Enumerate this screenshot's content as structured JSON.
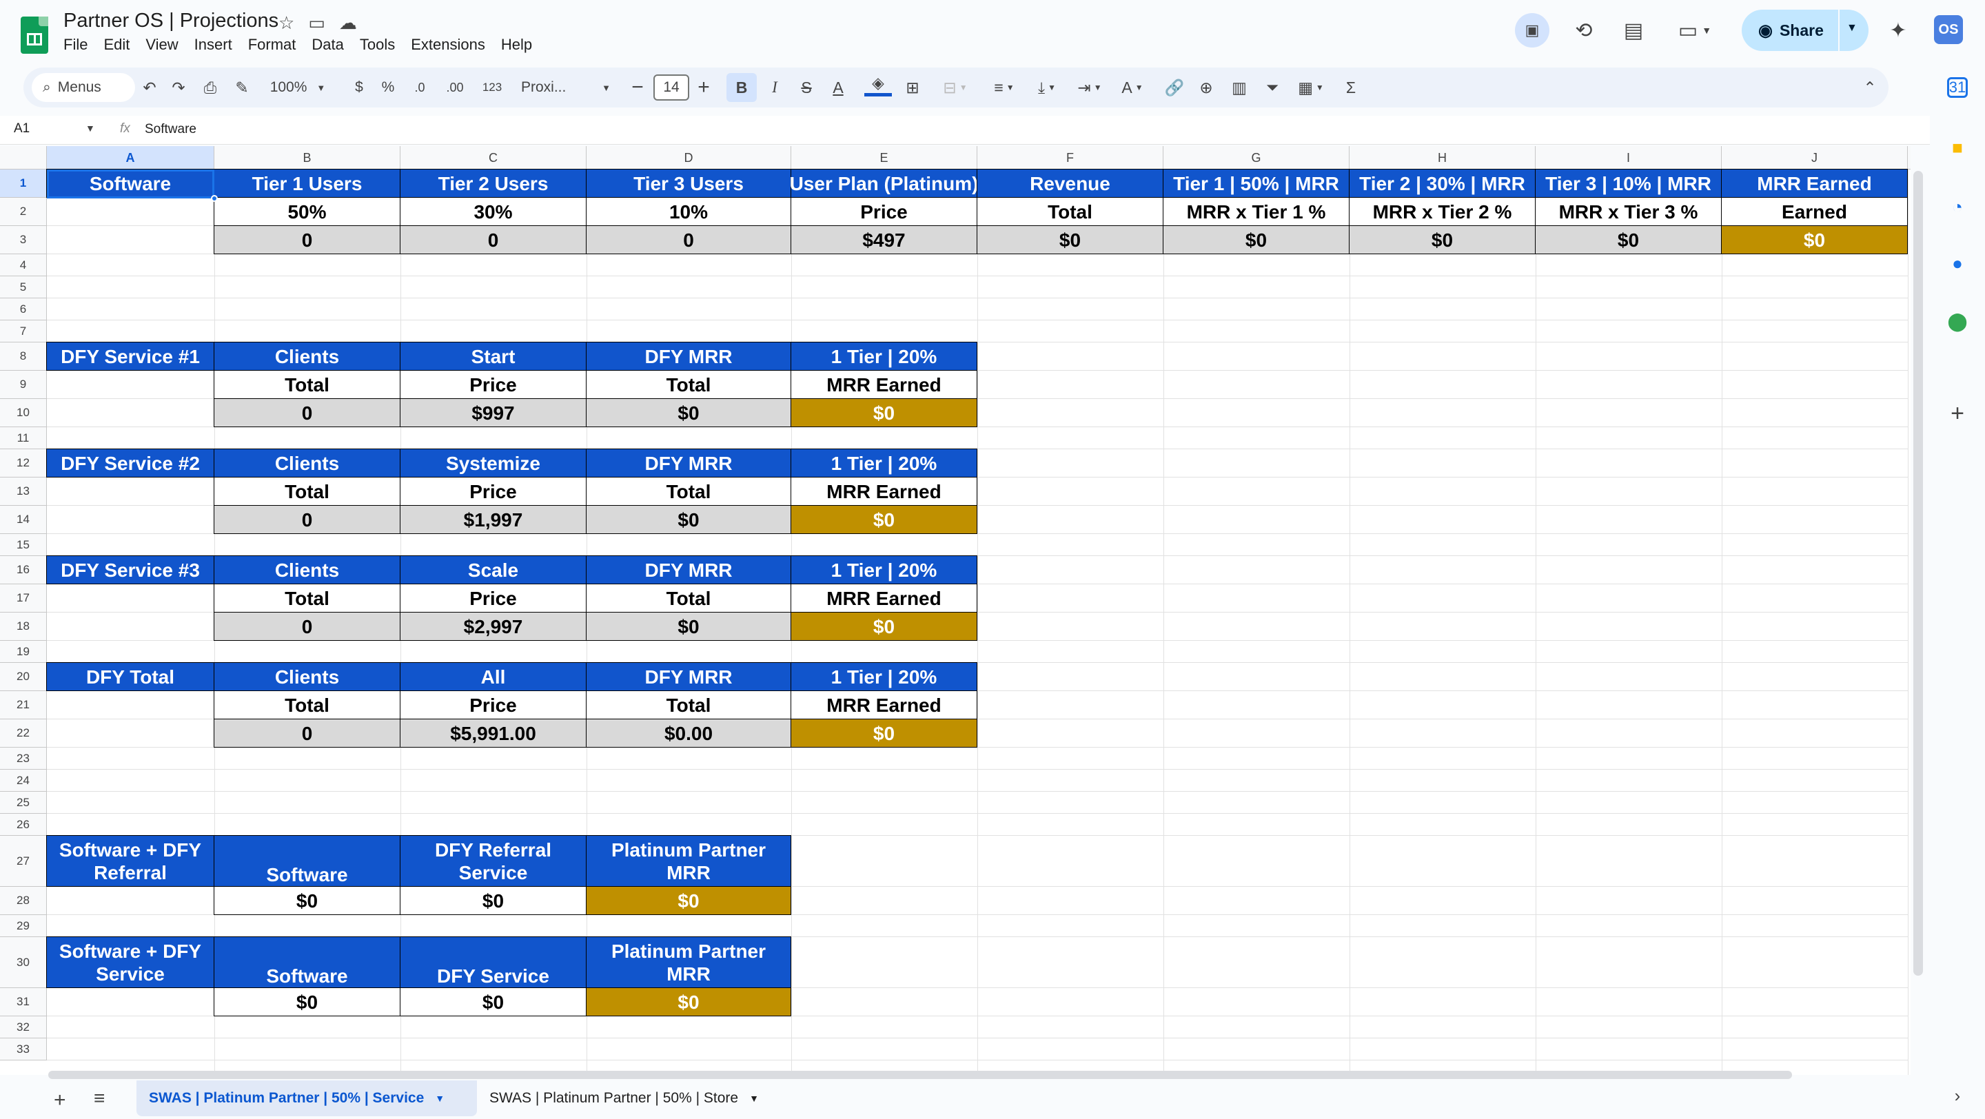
{
  "app": {
    "title": "Partner OS | Projections",
    "menu": [
      "File",
      "Edit",
      "View",
      "Insert",
      "Format",
      "Data",
      "Tools",
      "Extensions",
      "Help"
    ],
    "share_label": "Share",
    "avatar_text": "OS"
  },
  "toolbar": {
    "menus_label": "Menus",
    "zoom": "100%",
    "currency": "$",
    "percent": "%",
    "dec_less": ".0",
    "dec_more": ".00",
    "num_format": "123",
    "font": "Proxi...",
    "font_size": "14"
  },
  "formula_bar": {
    "cell_ref": "A1",
    "fx": "fx",
    "value": "Software"
  },
  "columns": [
    "A",
    "B",
    "C",
    "D",
    "E",
    "F",
    "G",
    "H",
    "I",
    "J"
  ],
  "rows": [
    "1",
    "2",
    "3",
    "4",
    "5",
    "6",
    "7",
    "8",
    "9",
    "10",
    "11",
    "12",
    "13",
    "14",
    "15",
    "16",
    "17",
    "18",
    "19",
    "20",
    "21",
    "22",
    "23",
    "24",
    "25",
    "26",
    "27",
    "28",
    "29",
    "30",
    "31",
    "32",
    "33"
  ],
  "software": {
    "headers": [
      "Software",
      "Tier 1 Users",
      "Tier 2 Users",
      "Tier 3 Users",
      "User Plan (Platinum)",
      "Revenue",
      "Tier 1 | 50% | MRR",
      "Tier 2 | 30% | MRR",
      "Tier 3 | 10% | MRR",
      "MRR Earned"
    ],
    "row2": [
      "50%",
      "30%",
      "10%",
      "Price",
      "Total",
      "MRR x Tier 1 %",
      "MRR x Tier 2 %",
      "MRR x Tier 3 %",
      "Earned"
    ],
    "row3": [
      "0",
      "0",
      "0",
      "$497",
      "$0",
      "$0",
      "$0",
      "$0",
      "$0"
    ]
  },
  "dfy_blocks": [
    {
      "headers": [
        "DFY Service #1",
        "Clients",
        "Start",
        "DFY MRR",
        "1 Tier | 20%"
      ],
      "sub": [
        "Total",
        "Price",
        "Total",
        "MRR Earned"
      ],
      "values": [
        "0",
        "$997",
        "$0",
        "$0"
      ]
    },
    {
      "headers": [
        "DFY Service #2",
        "Clients",
        "Systemize",
        "DFY MRR",
        "1 Tier | 20%"
      ],
      "sub": [
        "Total",
        "Price",
        "Total",
        "MRR Earned"
      ],
      "values": [
        "0",
        "$1,997",
        "$0",
        "$0"
      ]
    },
    {
      "headers": [
        "DFY Service #3",
        "Clients",
        "Scale",
        "DFY MRR",
        "1 Tier | 20%"
      ],
      "sub": [
        "Total",
        "Price",
        "Total",
        "MRR Earned"
      ],
      "values": [
        "0",
        "$2,997",
        "$0",
        "$0"
      ]
    },
    {
      "headers": [
        "DFY Total",
        "Clients",
        "All",
        "DFY MRR",
        "1 Tier | 20%"
      ],
      "sub": [
        "Total",
        "Price",
        "Total",
        "MRR Earned"
      ],
      "values": [
        "0",
        "$5,991.00",
        "$0.00",
        "$0"
      ]
    }
  ],
  "summary_blocks": [
    {
      "headers": [
        "Software + DFY Referral",
        "Software",
        "DFY Referral Service",
        "Platinum Partner MRR"
      ],
      "values": [
        "$0",
        "$0",
        "$0"
      ]
    },
    {
      "headers": [
        "Software + DFY Service",
        "Software",
        "DFY Service",
        "Platinum Partner MRR"
      ],
      "values": [
        "$0",
        "$0",
        "$0"
      ]
    }
  ],
  "tabs": [
    {
      "label": "SWAS | Platinum Partner | 50% | Service",
      "active": true
    },
    {
      "label": "SWAS | Platinum Partner | 50% | Store",
      "active": false
    }
  ],
  "colors": {
    "header_blue": "#1155cc",
    "gold": "#bf9000",
    "gray": "#d9d9d9",
    "sheets_green": "#0f9d58"
  }
}
